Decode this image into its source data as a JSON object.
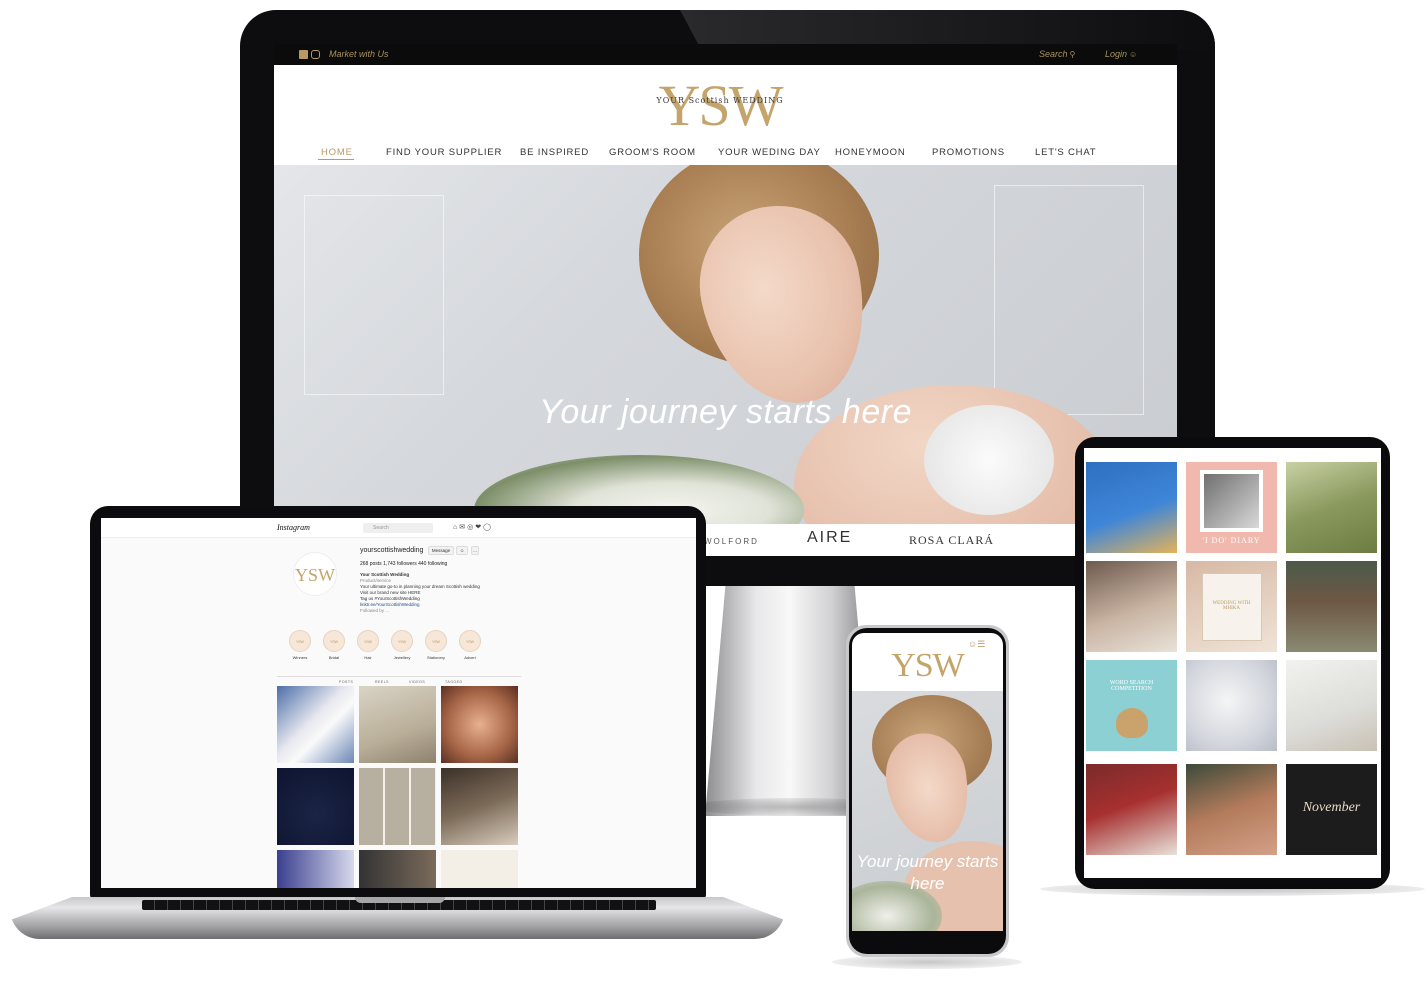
{
  "desktop": {
    "topbar": {
      "market_label": "Market with Us",
      "search_label": "Search",
      "login_label": "Login"
    },
    "logo": {
      "letters": "YSW",
      "script": "YOUR Scottish WEDDING"
    },
    "nav": [
      {
        "label": "HOME",
        "active": true
      },
      {
        "label": "FIND YOUR SUPPLIER"
      },
      {
        "label": "BE INSPIRED"
      },
      {
        "label": "GROOM'S ROOM"
      },
      {
        "label": "YOUR WEDING DAY"
      },
      {
        "label": "HONEYMOON"
      },
      {
        "label": "PROMOTIONS"
      },
      {
        "label": "LET'S CHAT"
      }
    ],
    "hero_tagline": "Your journey starts here",
    "brands": [
      "WOLFORD",
      "AIRE",
      "ROSA CLARÁ"
    ]
  },
  "laptop": {
    "brand": "Instagram",
    "search_placeholder": "Search",
    "avatar_letters": "YSW",
    "handle": "yourscottishwedding",
    "message_button": "Message",
    "stats": "268 posts   1,743 followers   440 following",
    "bio": {
      "name": "Your Scottish Wedding",
      "category": "Product/service",
      "line1": "Your ultimate go-to in planning your dream Scottish wedding",
      "line2": "Visit our brand new site HERE",
      "line3": "Tag us #YourScottishWedding",
      "link": "linktr.ee/YourScottishWedding",
      "followed_by": "Followed by ..."
    },
    "highlights": [
      {
        "label": "Winners"
      },
      {
        "label": "Bridal"
      },
      {
        "label": "Hair"
      },
      {
        "label": "Jewellery"
      },
      {
        "label": "Stationery"
      },
      {
        "label": "Advert"
      }
    ],
    "tabs": [
      "POSTS",
      "REELS",
      "VIDEOS",
      "TAGGED"
    ]
  },
  "tablet": {
    "tile_texts": [
      "'I DO' DIARY",
      "WEDDING WITH MHIKA",
      "WORD SEARCH COMPETITION",
      "November"
    ]
  },
  "phone": {
    "logo": "YSW",
    "tagline": "Your journey starts here"
  },
  "colors": {
    "gold": "#c4a46b",
    "topbar": "#0b0b0b",
    "device_frame": "#0d0d0f"
  }
}
